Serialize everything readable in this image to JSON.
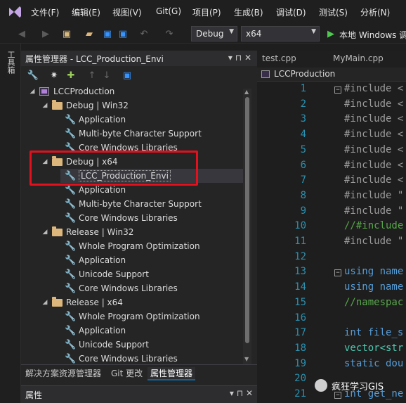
{
  "menubar": {
    "items": [
      "文件(F)",
      "编辑(E)",
      "视图(V)",
      "Git(G)",
      "项目(P)",
      "生成(B)",
      "调试(D)",
      "测试(S)",
      "分析(N)"
    ]
  },
  "toolbar": {
    "config": "Debug",
    "platform": "x64",
    "run_label": "本地 Windows 调"
  },
  "side_strip": {
    "label": "工具箱"
  },
  "panel": {
    "title": "属性管理器 - LCC_Production_Envi",
    "pin": "▾ ⊓ ✕"
  },
  "tree": {
    "root": "LCCProduction",
    "configs": [
      {
        "label": "Debug | Win32",
        "items": [
          "Application",
          "Multi-byte Character Support",
          "Core Windows Libraries"
        ]
      },
      {
        "label": "Debug | x64",
        "items": [
          "LCC_Production_Envi",
          "Application",
          "Multi-byte Character Support",
          "Core Windows Libraries"
        ]
      },
      {
        "label": "Release | Win32",
        "items": [
          "Whole Program Optimization",
          "Application",
          "Unicode Support",
          "Core Windows Libraries"
        ]
      },
      {
        "label": "Release | x64",
        "items": [
          "Whole Program Optimization",
          "Application",
          "Unicode Support",
          "Core Windows Libraries"
        ]
      }
    ]
  },
  "bottom_tabs": [
    "解决方案资源管理器",
    "Git 更改",
    "属性管理器"
  ],
  "properties_label": "属性",
  "editor": {
    "tabs": [
      "test.cpp",
      "MyMain.cpp"
    ],
    "nav": "LCCProduction",
    "lines": [
      {
        "n": "1",
        "t": "#include <",
        "c": "kw-dir",
        "fold": "⊟"
      },
      {
        "n": "2",
        "t": "#include <",
        "c": "kw-dir"
      },
      {
        "n": "3",
        "t": "#include <",
        "c": "kw-dir"
      },
      {
        "n": "4",
        "t": "#include <",
        "c": "kw-dir"
      },
      {
        "n": "5",
        "t": "#include <",
        "c": "kw-dir"
      },
      {
        "n": "6",
        "t": "#include <",
        "c": "kw-dir"
      },
      {
        "n": "7",
        "t": "#include <",
        "c": "kw-dir"
      },
      {
        "n": "8",
        "t": "#include \"",
        "c": "kw-dir"
      },
      {
        "n": "9",
        "t": "#include \"",
        "c": "kw-dir"
      },
      {
        "n": "10",
        "t": "//#include",
        "c": "cm"
      },
      {
        "n": "11",
        "t": "#include \"",
        "c": "kw-dir"
      },
      {
        "n": "12",
        "t": "",
        "c": "id"
      },
      {
        "n": "13",
        "t": "using name",
        "c": "kw",
        "fold": "⊟"
      },
      {
        "n": "14",
        "t": "using name",
        "c": "kw"
      },
      {
        "n": "15",
        "t": "//namespac",
        "c": "cm"
      },
      {
        "n": "16",
        "t": "",
        "c": "id"
      },
      {
        "n": "17",
        "t": "int file_s",
        "c": "kw"
      },
      {
        "n": "18",
        "t": "vector<str",
        "c": "ty"
      },
      {
        "n": "19",
        "t": "static dou",
        "c": "kw"
      },
      {
        "n": "20",
        "t": "",
        "c": "id"
      },
      {
        "n": "21",
        "t": "int get_ne",
        "c": "kw",
        "fold": "⊟"
      }
    ]
  },
  "watermark": {
    "text": "疯狂学习GIS"
  }
}
